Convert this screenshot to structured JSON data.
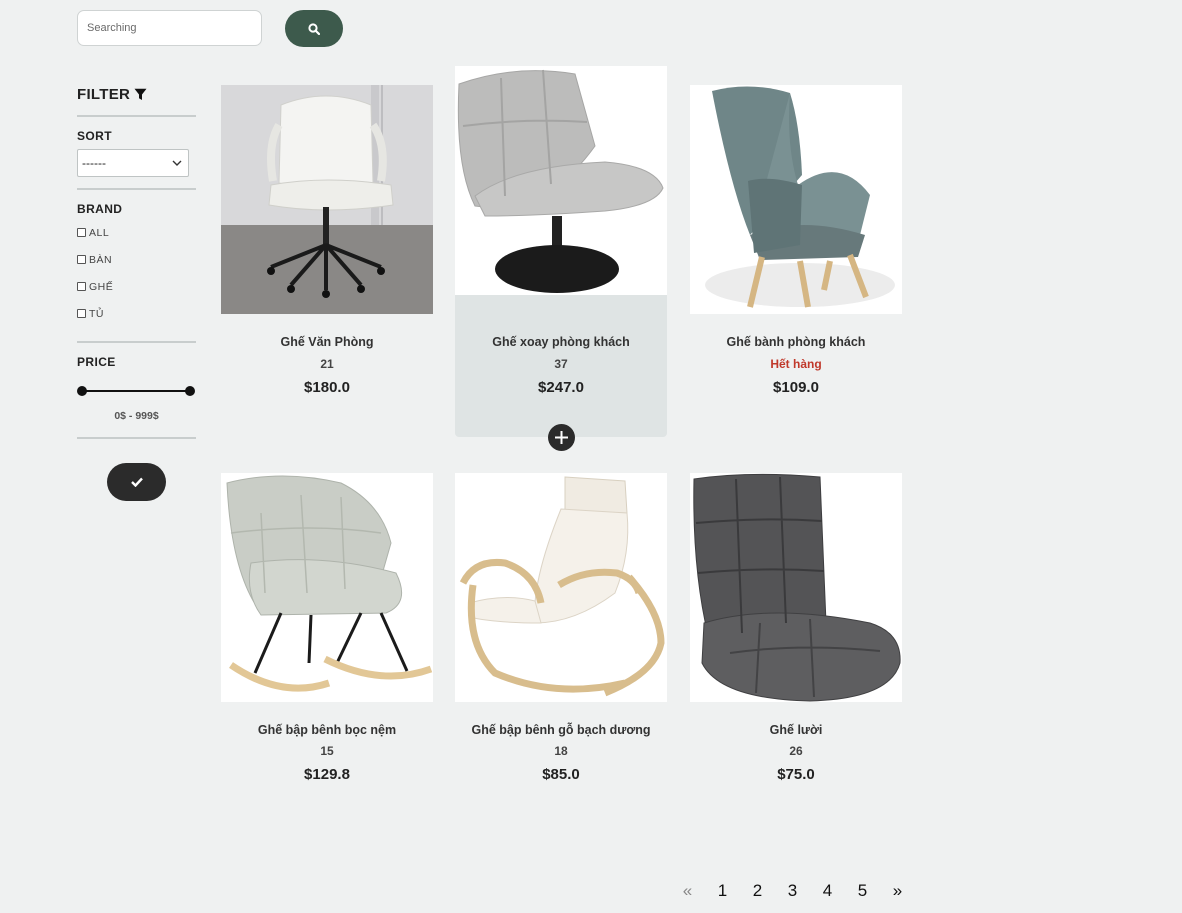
{
  "search": {
    "placeholder": "Searching",
    "button_icon": "search-icon"
  },
  "filter": {
    "title": "FILTER",
    "sort": {
      "label": "SORT",
      "selected": "------"
    },
    "brand": {
      "label": "BRAND",
      "options": [
        "ALL",
        "BÀN",
        "GHẾ",
        "TỦ"
      ]
    },
    "price": {
      "label": "PRICE",
      "range_text": "0$ - 999$",
      "min_fraction": 0,
      "max_fraction": 1
    },
    "apply_icon": "check-icon"
  },
  "products": [
    {
      "name": "Ghế Văn Phòng",
      "quantity": "21",
      "price": "$180.0"
    },
    {
      "name": "Ghế xoay phòng khách",
      "quantity": "37",
      "price": "$247.0"
    },
    {
      "name": "Ghế bành phòng khách",
      "quantity": "Hết hàng",
      "price": "$109.0"
    },
    {
      "name": "Ghế bập bênh bọc nệm",
      "quantity": "15",
      "price": "$129.8"
    },
    {
      "name": "Ghế bập bênh gỗ bạch dương",
      "quantity": "18",
      "price": "$85.0"
    },
    {
      "name": "Ghế lười",
      "quantity": "26",
      "price": "$75.0"
    }
  ],
  "colors": {
    "search_button": "#3d5a4c",
    "out_of_stock": "#c0392b",
    "background": "#eff1f1"
  },
  "pagination": {
    "prev": "«",
    "pages": [
      "1",
      "2",
      "3",
      "4",
      "5"
    ],
    "next": "»"
  }
}
